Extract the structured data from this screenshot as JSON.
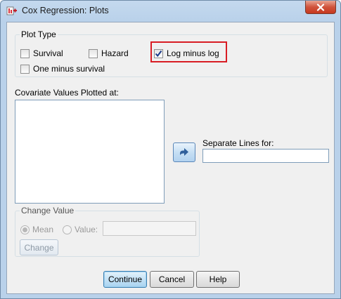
{
  "window": {
    "title": "Cox Regression: Plots"
  },
  "plot_type": {
    "legend": "Plot Type",
    "options": [
      {
        "label": "Survival",
        "checked": false
      },
      {
        "label": "Hazard",
        "checked": false
      },
      {
        "label": "Log minus log",
        "checked": true
      },
      {
        "label": "One minus survival",
        "checked": false
      }
    ]
  },
  "covariates": {
    "label": "Covariate Values Plotted at:"
  },
  "separate_lines": {
    "label": "Separate Lines for:",
    "value": ""
  },
  "change_value": {
    "legend": "Change Value",
    "mean_label": "Mean",
    "value_label": "Value:",
    "value_input": "",
    "change_button": "Change"
  },
  "buttons": {
    "continue": "Continue",
    "cancel": "Cancel",
    "help": "Help"
  },
  "colors": {
    "highlight": "#d81c24",
    "default_button": "#3c7fb1"
  }
}
